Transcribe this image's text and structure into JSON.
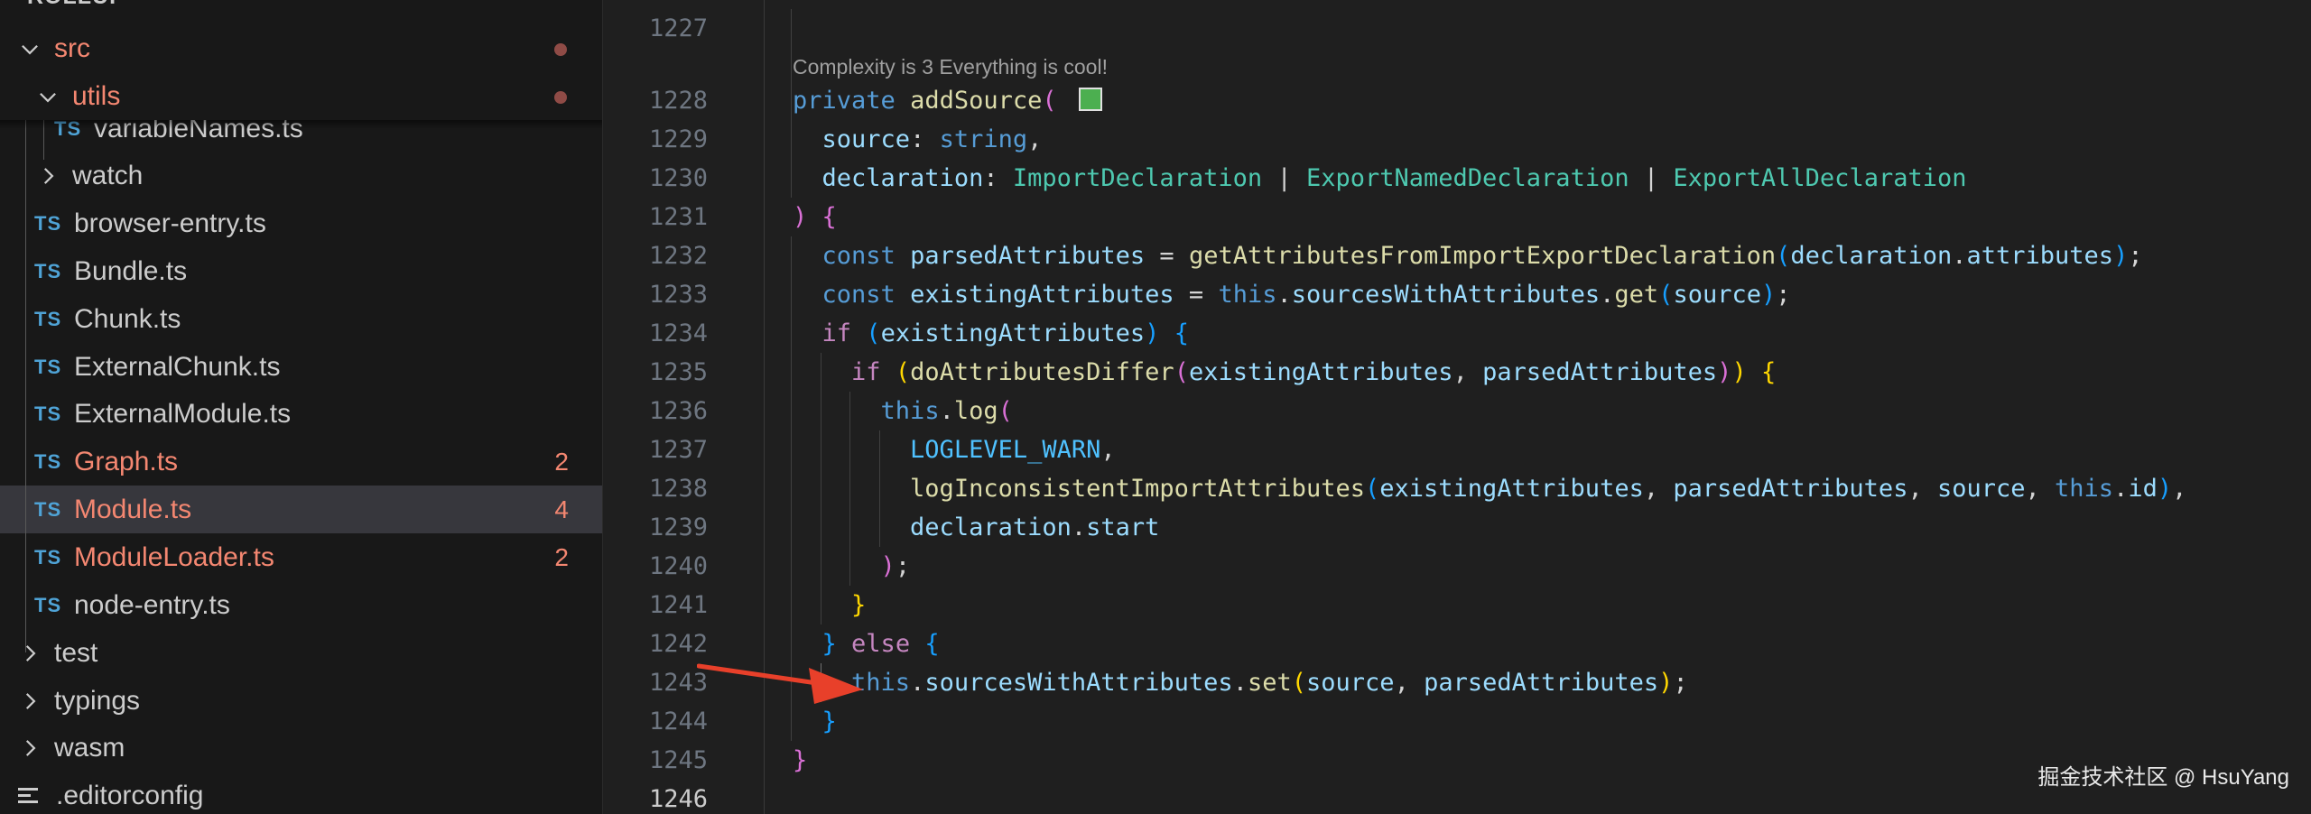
{
  "explorer": {
    "root_label": "ROLLUP",
    "items": [
      {
        "kind": "folder",
        "open": true,
        "label": "src",
        "modified_dot": true,
        "error": true
      },
      {
        "kind": "folder",
        "open": true,
        "label": "utils",
        "modified_dot": true,
        "error": true
      },
      {
        "kind": "file",
        "icon": "TS",
        "label": "variableNames.ts"
      },
      {
        "kind": "folder",
        "open": false,
        "label": "watch"
      },
      {
        "kind": "file",
        "icon": "TS",
        "label": "browser-entry.ts"
      },
      {
        "kind": "file",
        "icon": "TS",
        "label": "Bundle.ts"
      },
      {
        "kind": "file",
        "icon": "TS",
        "label": "Chunk.ts"
      },
      {
        "kind": "file",
        "icon": "TS",
        "label": "ExternalChunk.ts"
      },
      {
        "kind": "file",
        "icon": "TS",
        "label": "ExternalModule.ts"
      },
      {
        "kind": "file",
        "icon": "TS",
        "label": "Graph.ts",
        "problems": "2",
        "error": true
      },
      {
        "kind": "file",
        "icon": "TS",
        "label": "Module.ts",
        "problems": "4",
        "error": true,
        "selected": true
      },
      {
        "kind": "file",
        "icon": "TS",
        "label": "ModuleLoader.ts",
        "problems": "2",
        "error": true
      },
      {
        "kind": "file",
        "icon": "TS",
        "label": "node-entry.ts"
      },
      {
        "kind": "folder",
        "open": false,
        "label": "test"
      },
      {
        "kind": "folder",
        "open": false,
        "label": "typings"
      },
      {
        "kind": "folder",
        "open": false,
        "label": "wasm"
      },
      {
        "kind": "file",
        "icon": "lines",
        "label": ".editorconfig"
      }
    ]
  },
  "editor": {
    "codelens": "Complexity is 3 Everything is cool!",
    "line_numbers": [
      "1227",
      "1228",
      "1229",
      "1230",
      "1231",
      "1232",
      "1233",
      "1234",
      "1235",
      "1236",
      "1237",
      "1238",
      "1239",
      "1240",
      "1241",
      "1242",
      "1243",
      "1244",
      "1245",
      "1246"
    ],
    "current_line": "1246",
    "colors": {
      "keyword": "#c586c0",
      "storage": "#569cd6",
      "function": "#dcdcaa",
      "variable": "#9cdcfe",
      "type": "#4ec9b0",
      "constant": "#4fc1ff",
      "swatch": "#4caf50",
      "arrow": "#e8402a"
    },
    "code": [
      [],
      [
        [
          "k2",
          "private"
        ],
        [
          "p",
          " "
        ],
        [
          "f",
          "addSource"
        ],
        [
          "bp",
          "("
        ],
        [
          "p",
          " "
        ],
        [
          "sw",
          ""
        ]
      ],
      [
        [
          "p",
          "  "
        ],
        [
          "v",
          "source"
        ],
        [
          "p",
          ": "
        ],
        [
          "k2",
          "string"
        ],
        [
          "p",
          ","
        ]
      ],
      [
        [
          "p",
          "  "
        ],
        [
          "v",
          "declaration"
        ],
        [
          "p",
          ": "
        ],
        [
          "t",
          "ImportDeclaration"
        ],
        [
          "p",
          " | "
        ],
        [
          "t",
          "ExportNamedDeclaration"
        ],
        [
          "p",
          " | "
        ],
        [
          "t",
          "ExportAllDeclaration"
        ]
      ],
      [
        [
          "bp",
          ")"
        ],
        [
          "p",
          " "
        ],
        [
          "bp",
          "{"
        ]
      ],
      [
        [
          "p",
          "  "
        ],
        [
          "k2",
          "const"
        ],
        [
          "p",
          " "
        ],
        [
          "v",
          "parsedAttributes"
        ],
        [
          "p",
          " = "
        ],
        [
          "f",
          "getAttributesFromImportExportDeclaration"
        ],
        [
          "bb",
          "("
        ],
        [
          "v",
          "declaration"
        ],
        [
          "p",
          "."
        ],
        [
          "v",
          "attributes"
        ],
        [
          "bb",
          ")"
        ],
        [
          "p",
          ";"
        ]
      ],
      [
        [
          "p",
          "  "
        ],
        [
          "k2",
          "const"
        ],
        [
          "p",
          " "
        ],
        [
          "v",
          "existingAttributes"
        ],
        [
          "p",
          " = "
        ],
        [
          "k2",
          "this"
        ],
        [
          "p",
          "."
        ],
        [
          "v",
          "sourcesWithAttributes"
        ],
        [
          "p",
          "."
        ],
        [
          "f",
          "get"
        ],
        [
          "bb",
          "("
        ],
        [
          "v",
          "source"
        ],
        [
          "bb",
          ")"
        ],
        [
          "p",
          ";"
        ]
      ],
      [
        [
          "p",
          "  "
        ],
        [
          "k",
          "if"
        ],
        [
          "p",
          " "
        ],
        [
          "bb",
          "("
        ],
        [
          "v",
          "existingAttributes"
        ],
        [
          "bb",
          ")"
        ],
        [
          "p",
          " "
        ],
        [
          "bb",
          "{"
        ]
      ],
      [
        [
          "p",
          "    "
        ],
        [
          "k",
          "if"
        ],
        [
          "p",
          " "
        ],
        [
          "by",
          "("
        ],
        [
          "f",
          "doAttributesDiffer"
        ],
        [
          "bp",
          "("
        ],
        [
          "v",
          "existingAttributes"
        ],
        [
          "p",
          ", "
        ],
        [
          "v",
          "parsedAttributes"
        ],
        [
          "bp",
          ")"
        ],
        [
          "by",
          ")"
        ],
        [
          "p",
          " "
        ],
        [
          "by",
          "{"
        ]
      ],
      [
        [
          "p",
          "      "
        ],
        [
          "k2",
          "this"
        ],
        [
          "p",
          "."
        ],
        [
          "f",
          "log"
        ],
        [
          "bp",
          "("
        ]
      ],
      [
        [
          "p",
          "        "
        ],
        [
          "c",
          "LOGLEVEL_WARN"
        ],
        [
          "p",
          ","
        ]
      ],
      [
        [
          "p",
          "        "
        ],
        [
          "f",
          "logInconsistentImportAttributes"
        ],
        [
          "bb",
          "("
        ],
        [
          "v",
          "existingAttributes"
        ],
        [
          "p",
          ", "
        ],
        [
          "v",
          "parsedAttributes"
        ],
        [
          "p",
          ", "
        ],
        [
          "v",
          "source"
        ],
        [
          "p",
          ", "
        ],
        [
          "k2",
          "this"
        ],
        [
          "p",
          "."
        ],
        [
          "v",
          "id"
        ],
        [
          "bb",
          ")"
        ],
        [
          "p",
          ","
        ]
      ],
      [
        [
          "p",
          "        "
        ],
        [
          "v",
          "declaration"
        ],
        [
          "p",
          "."
        ],
        [
          "v",
          "start"
        ]
      ],
      [
        [
          "p",
          "      "
        ],
        [
          "bp",
          ")"
        ],
        [
          "p",
          ";"
        ]
      ],
      [
        [
          "p",
          "    "
        ],
        [
          "by",
          "}"
        ]
      ],
      [
        [
          "p",
          "  "
        ],
        [
          "bb",
          "}"
        ],
        [
          "p",
          " "
        ],
        [
          "k",
          "else"
        ],
        [
          "p",
          " "
        ],
        [
          "bb",
          "{"
        ]
      ],
      [
        [
          "p",
          "    "
        ],
        [
          "k2",
          "this"
        ],
        [
          "p",
          "."
        ],
        [
          "v",
          "sourcesWithAttributes"
        ],
        [
          "p",
          "."
        ],
        [
          "f",
          "set"
        ],
        [
          "by",
          "("
        ],
        [
          "v",
          "source"
        ],
        [
          "p",
          ", "
        ],
        [
          "v",
          "parsedAttributes"
        ],
        [
          "by",
          ")"
        ],
        [
          "p",
          ";"
        ]
      ],
      [
        [
          "p",
          "  "
        ],
        [
          "bb",
          "}"
        ]
      ],
      [
        [
          "bp",
          "}"
        ]
      ],
      []
    ]
  },
  "watermark": "掘金技术社区 @ HsuYang"
}
